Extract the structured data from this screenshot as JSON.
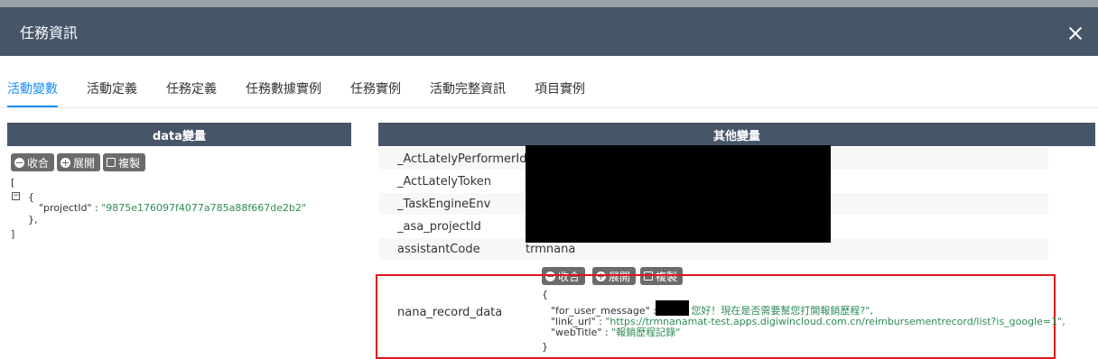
{
  "dialog": {
    "title": "任務資訊"
  },
  "tabs": [
    {
      "label": "活動變數",
      "active": true
    },
    {
      "label": "活動定義"
    },
    {
      "label": "任務定義"
    },
    {
      "label": "任務數據實例"
    },
    {
      "label": "任務實例"
    },
    {
      "label": "活動完整資訊"
    },
    {
      "label": "項目實例"
    }
  ],
  "left_panel": {
    "title": "data變量",
    "buttons": {
      "collapse": "收合",
      "expand": "展開",
      "copy": "複製"
    },
    "json": {
      "open_bracket": "[",
      "open_brace": "{",
      "project_key": "\"projectId\"",
      "colon": " : ",
      "project_val": "\"9875e176097f4077a785a88f667de2b2\"",
      "close_brace": "},",
      "close_bracket": "]"
    }
  },
  "right_panel": {
    "title": "其他變量",
    "rows": [
      {
        "key": "_ActLatelyPerformerId",
        "value": ""
      },
      {
        "key": "_ActLatelyToken",
        "value": ""
      },
      {
        "key": "_TaskEngineEnv",
        "value": ""
      },
      {
        "key": "_asa_projectId",
        "value": ""
      },
      {
        "key": "assistantCode",
        "value": "trmnana"
      }
    ],
    "nana_record": {
      "key": "nana_record_data",
      "buttons": {
        "collapse": "收合",
        "expand": "展開",
        "copy": "複製"
      },
      "json": {
        "open_brace": "{",
        "msg_key": "\"for_user_message\" : \"",
        "msg_val": "您好！現在是否需要幫您打開報銷歷程?\",",
        "link_key": "\"link_url\" : ",
        "link_val": "\"https://trmnanamat-test.apps.digiwincloud.com.cn/reimbursementrecord/list?is_google=1\",",
        "title_key": "\"webTitle\" : ",
        "title_val": "\"報銷歷程記錄\"",
        "close_brace": "}"
      }
    }
  },
  "colors": {
    "header_bg": "#475569",
    "accent": "#1890ff",
    "highlight_border": "#e0161b",
    "string_green": "#2e8b57"
  }
}
